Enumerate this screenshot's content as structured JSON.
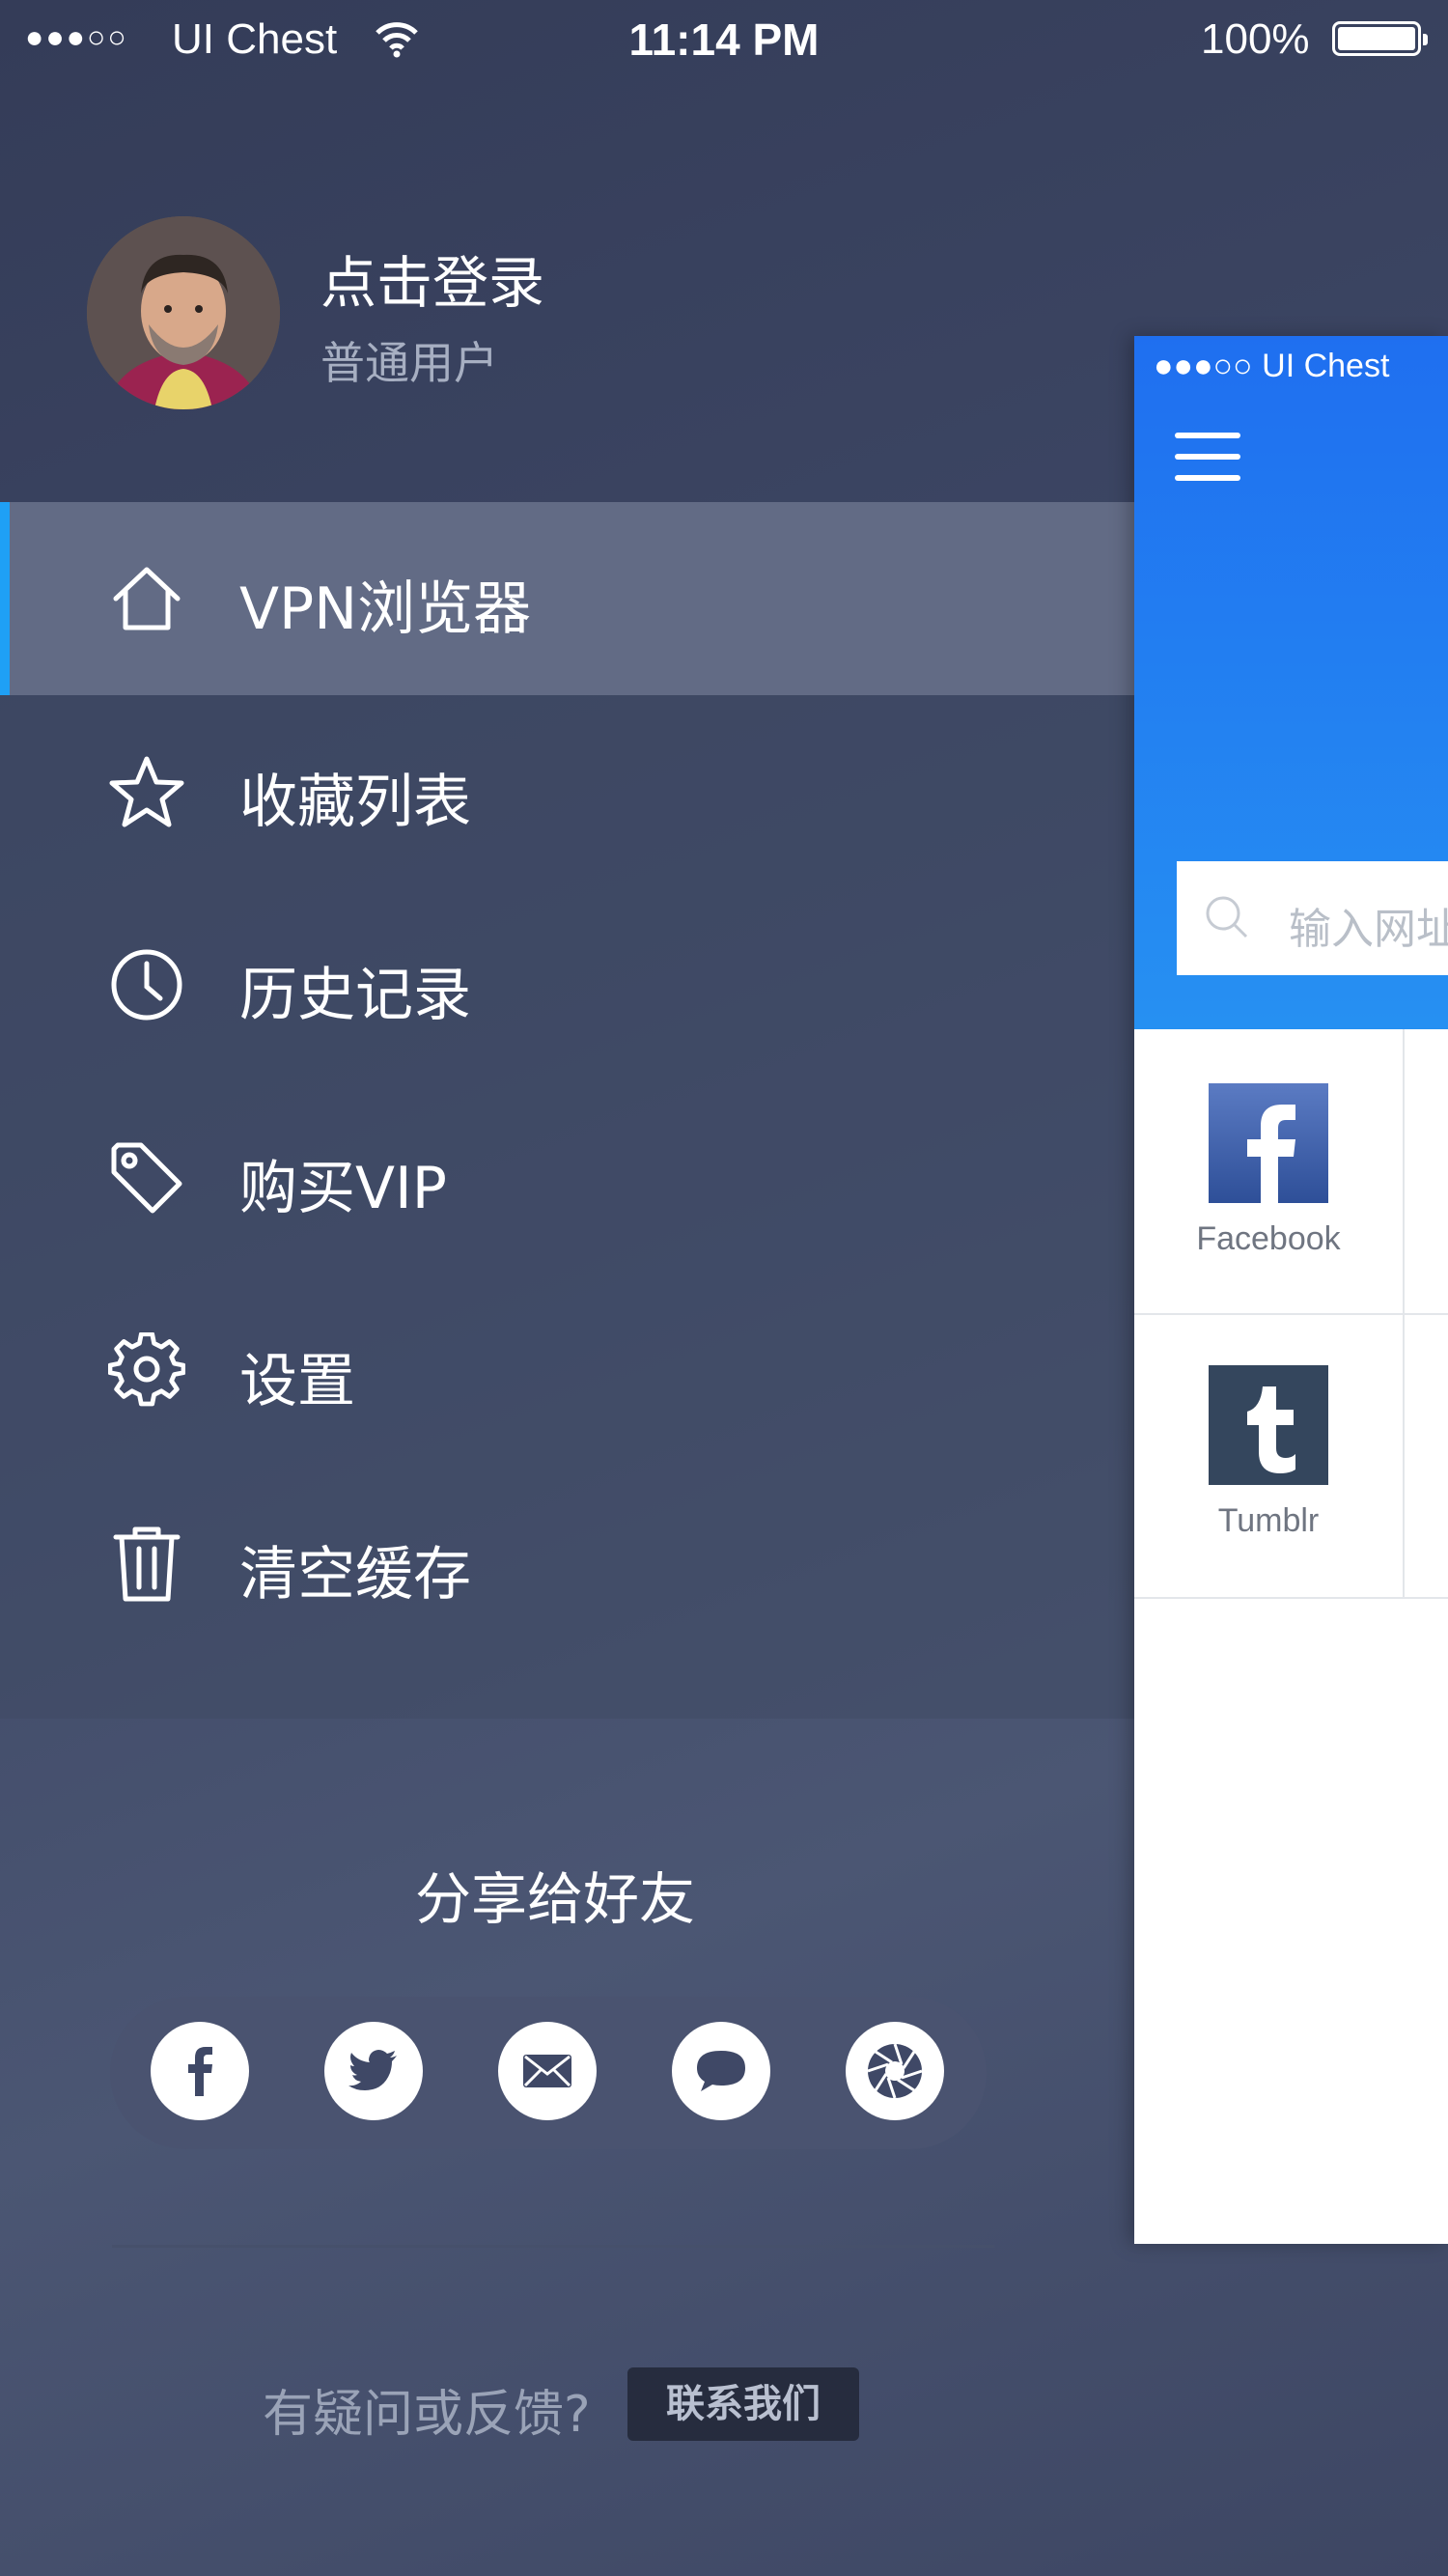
{
  "status_bar": {
    "signal": "●●●○○",
    "carrier": "UI Chest",
    "time": "11:14 PM",
    "battery_percent": "100%"
  },
  "profile": {
    "username": "点击登录",
    "user_type": "普通用户"
  },
  "menu": {
    "items": [
      {
        "label": "VPN浏览器",
        "icon": "home-icon",
        "active": true
      },
      {
        "label": "收藏列表",
        "icon": "star-icon",
        "active": false
      },
      {
        "label": "历史记录",
        "icon": "clock-icon",
        "active": false
      },
      {
        "label": "购买VIP",
        "icon": "tag-icon",
        "active": false
      },
      {
        "label": "设置",
        "icon": "gear-icon",
        "active": false
      },
      {
        "label": "清空缓存",
        "icon": "trash-icon",
        "active": false
      }
    ]
  },
  "share": {
    "title": "分享给好友",
    "buttons": [
      "facebook-icon",
      "twitter-icon",
      "email-icon",
      "chat-bubble-icon",
      "aperture-icon"
    ]
  },
  "feedback": {
    "question": "有疑问或反馈?",
    "contact_label": "联系我们"
  },
  "preview": {
    "status_signal": "●●●○○",
    "status_carrier": "UI Chest",
    "search_placeholder": "输入网址",
    "tiles": [
      {
        "name": "Facebook",
        "icon": "facebook-logo-icon"
      },
      {
        "name": "Tumblr",
        "icon": "tumblr-logo-icon"
      }
    ]
  },
  "colors": {
    "accent": "#1fa0f5",
    "preview_header": "#2285f1",
    "active_row": "#626b85"
  }
}
